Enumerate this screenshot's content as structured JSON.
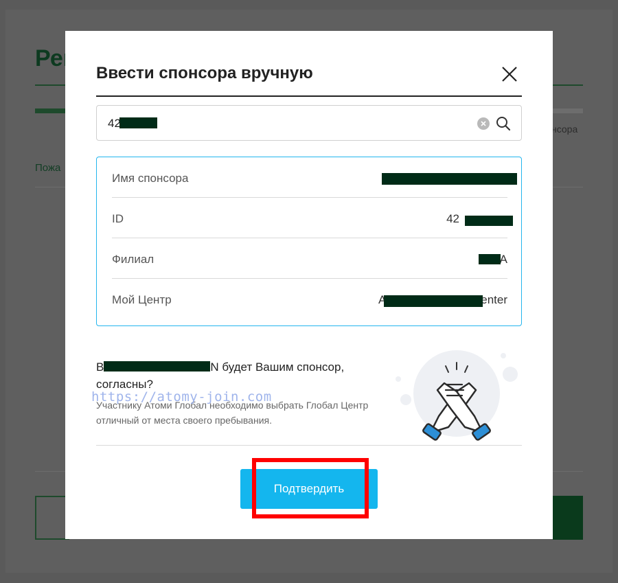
{
  "background": {
    "title_fragment": "Рег",
    "step_fragment": "нсора",
    "please_fragment": "Пожа"
  },
  "modal": {
    "title": "Ввести спонсора вручную",
    "search": {
      "value": "42",
      "placeholder": ""
    },
    "info": {
      "sponsor_name_label": "Имя спонсора",
      "sponsor_name_value": "",
      "id_label": "ID",
      "id_value": "42",
      "branch_label": "Филиал",
      "branch_value": "A",
      "center_label": "Мой Центр",
      "center_value_start": "A",
      "center_value_end": "enter"
    },
    "confirm_question_start": "В",
    "confirm_question_end": "N будет Вашим спонсор, согласны?",
    "note": "Участнику Атоми Глобал необходимо выбрать Глобал Центр отличный от места своего пребывания.",
    "watermark": "https://atomy-join.com",
    "confirm_button": "Подтвердить"
  },
  "colors": {
    "accent": "#14b6ee",
    "highlight": "#ff0000",
    "brand_dark": "#0d3a20"
  }
}
